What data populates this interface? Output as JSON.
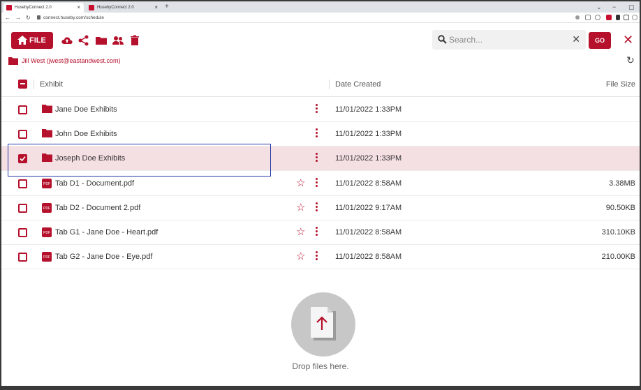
{
  "browser": {
    "tabs": [
      {
        "label": "HusebyConnect 2.0",
        "active": true
      },
      {
        "label": "HusebyConnect 2.0",
        "active": false
      }
    ],
    "new_tab": "+",
    "url": "connect.huseby.com/schedule",
    "window_controls": [
      "⌄",
      "−",
      "▢"
    ]
  },
  "toolbar": {
    "file_label": "FILE",
    "search_placeholder": "Search...",
    "go_label": "GO",
    "icons": [
      "upload-cloud-icon",
      "share-icon",
      "folder-icon",
      "users-icon",
      "trash-icon"
    ]
  },
  "breadcrumb": {
    "label": "Jill West (jwest@eastandwest.com)"
  },
  "table": {
    "headers": {
      "exhibit": "Exhibit",
      "date_created": "Date Created",
      "file_size": "File Size"
    },
    "rows": [
      {
        "type": "folder",
        "name": "Jane Doe Exhibits",
        "date": "11/01/2022 1:33PM",
        "size": "",
        "selected": false
      },
      {
        "type": "folder",
        "name": "John Doe Exhibits",
        "date": "11/01/2022 1:33PM",
        "size": "",
        "selected": false
      },
      {
        "type": "folder",
        "name": "Joseph Doe Exhibits",
        "date": "11/01/2022 1:33PM",
        "size": "",
        "selected": true
      },
      {
        "type": "pdf",
        "name": "Tab D1 - Document.pdf",
        "date": "11/01/2022 8:58AM",
        "size": "3.38MB",
        "selected": false
      },
      {
        "type": "pdf",
        "name": "Tab D2 - Document 2.pdf",
        "date": "11/01/2022 9:17AM",
        "size": "90.50KB",
        "selected": false
      },
      {
        "type": "pdf",
        "name": "Tab G1 - Jane Doe - Heart.pdf",
        "date": "11/01/2022 8:58AM",
        "size": "310.10KB",
        "selected": false
      },
      {
        "type": "pdf",
        "name": "Tab G2 - Jane Doe - Eye.pdf",
        "date": "11/01/2022 8:58AM",
        "size": "210.00KB",
        "selected": false
      }
    ]
  },
  "dropzone": {
    "label": "Drop files here."
  },
  "colors": {
    "brand": "#b5112c",
    "selected_row": "#f4dfe3",
    "highlight_box": "#2a3aa8"
  }
}
